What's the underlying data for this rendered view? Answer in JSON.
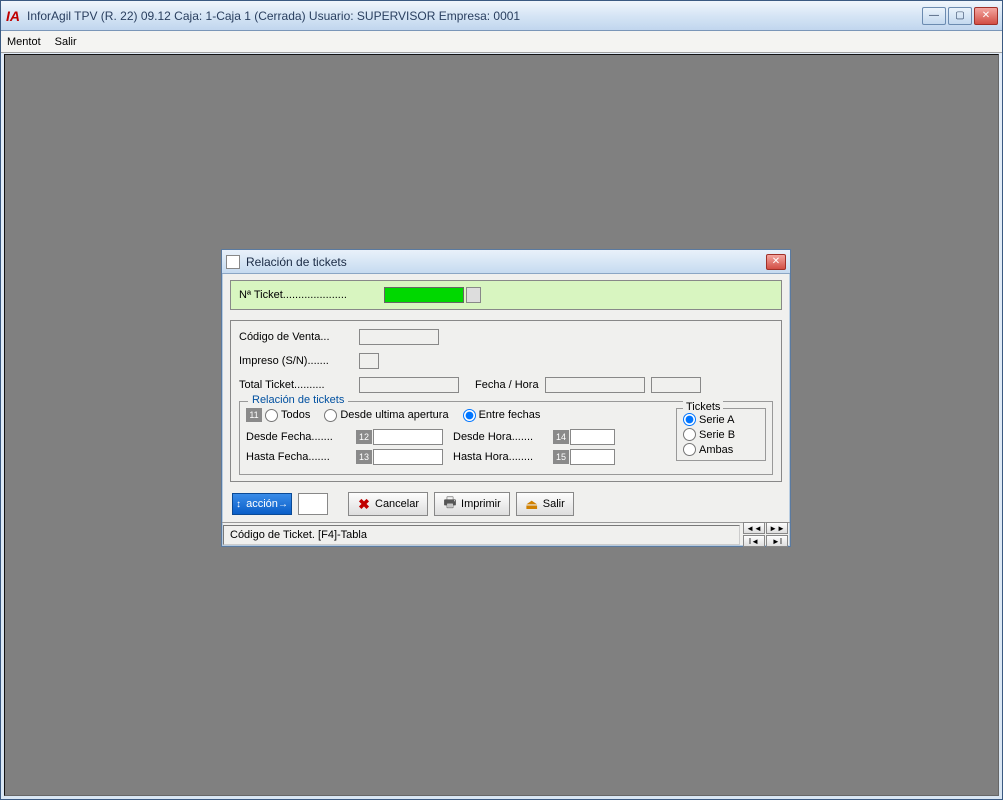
{
  "titlebar": {
    "app_icon_text": "IA",
    "title": "InforAgil TPV (R. 22) 09.12 Caja: 1-Caja 1 (Cerrada)  Usuario: SUPERVISOR  Empresa: 0001"
  },
  "menubar": {
    "items": [
      "Mentot",
      "Salir"
    ]
  },
  "dialog": {
    "title": "Relación de tickets",
    "ticket_label": "Nª Ticket.....................",
    "ticket_value": "",
    "codigo_venta_label": "Código de Venta...",
    "codigo_venta_value": "",
    "impreso_label": "Impreso (S/N).......",
    "impreso_value": "",
    "total_label": "Total Ticket..........",
    "total_value": "",
    "fecha_hora_label": "Fecha / Hora",
    "fecha_value": "",
    "hora_value": "",
    "fieldset_legend": "Relación de tickets",
    "badge11": "11",
    "radio_todos": "Todos",
    "radio_desde_apertura": "Desde ultima apertura",
    "radio_entre_fechas": "Entre fechas",
    "selected_filter": "entre_fechas",
    "desde_fecha_label": "Desde Fecha.......",
    "badge12": "12",
    "desde_fecha_value": "",
    "desde_hora_label": "Desde Hora.......",
    "badge14": "14",
    "desde_hora_value": "",
    "hasta_fecha_label": "Hasta Fecha.......",
    "badge13": "13",
    "hasta_fecha_value": "",
    "hasta_hora_label": "Hasta Hora........",
    "badge15": "15",
    "hasta_hora_value": "",
    "tickets_legend": "Tickets",
    "tickets_serie_a": "Serie A",
    "tickets_serie_b": "Serie B",
    "tickets_ambas": "Ambas",
    "tickets_selected": "serie_a",
    "accion_label": "acción",
    "accion_value": "",
    "cancel_label": "Cancelar",
    "print_label": "Imprimir",
    "exit_label": "Salir",
    "status_text": "Código de Ticket. [F4]-Tabla",
    "nav": {
      "first": "◄◄",
      "prev": "►►",
      "back": "I◄",
      "fwd": "►I"
    }
  }
}
